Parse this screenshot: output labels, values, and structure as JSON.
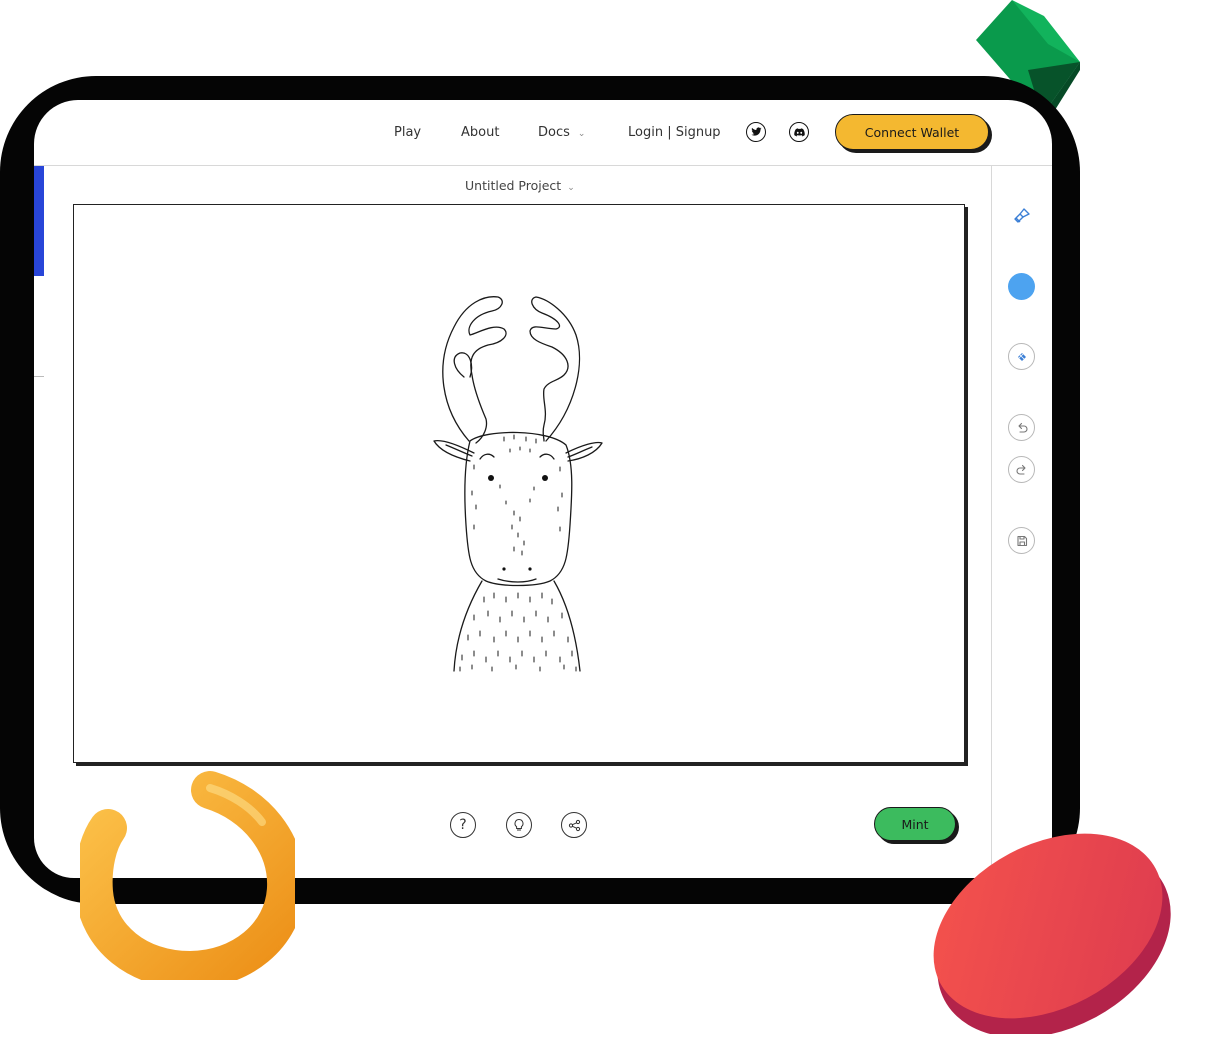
{
  "nav": {
    "play": "Play",
    "about": "About",
    "docs": "Docs",
    "login": "Login | Signup",
    "connect_wallet": "Connect Wallet"
  },
  "social": [
    "twitter-icon",
    "discord-icon"
  ],
  "project": {
    "title": "Untitled Project"
  },
  "tools": [
    "brush-icon",
    "color-swatch",
    "fill-icon",
    "undo-icon",
    "redo-icon",
    "save-icon"
  ],
  "bottom": {
    "icons": [
      "help-icon",
      "lightbulb-icon",
      "share-icon"
    ],
    "mint": "Mint"
  },
  "colors": {
    "accent_blue": "#2845d8",
    "wallet_yellow": "#f4b830",
    "mint_green": "#3cbb5e",
    "color_swatch": "#4da3f0",
    "brush_blue": "#3b7fd6"
  }
}
